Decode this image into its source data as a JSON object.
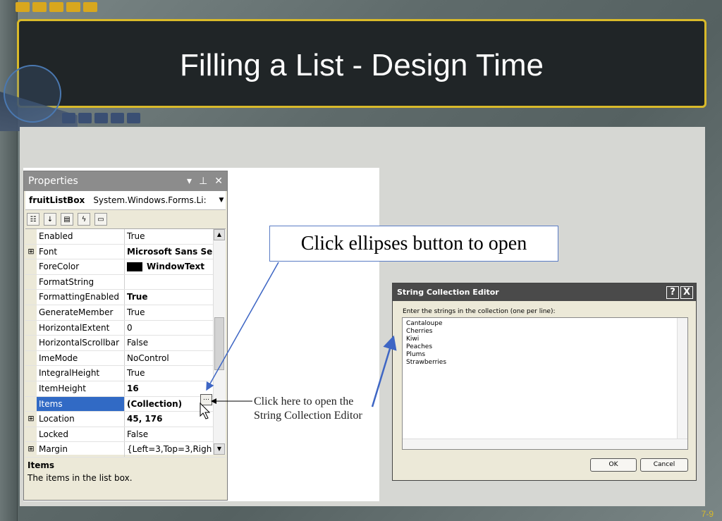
{
  "slide": {
    "title": "Filling a List - Design Time",
    "page_number": "7-9"
  },
  "colors": {
    "title_bg": "#202527",
    "title_border": "#d9ba2a",
    "accent_blue": "#4a78b0",
    "selection": "#316ac5"
  },
  "properties_window": {
    "title": "Properties",
    "object_name": "fruitListBox",
    "object_type": "System.Windows.Forms.Li:",
    "icons": [
      "dropdown-icon",
      "pin-icon",
      "close-icon"
    ],
    "rows": [
      {
        "name": "Enabled",
        "value": "True"
      },
      {
        "name": "Font",
        "value": "Microsoft Sans Se",
        "expand": "⊞"
      },
      {
        "name": "ForeColor",
        "value": "WindowText"
      },
      {
        "name": "FormatString",
        "value": ""
      },
      {
        "name": "FormattingEnabled",
        "value": "True"
      },
      {
        "name": "GenerateMember",
        "value": "True"
      },
      {
        "name": "HorizontalExtent",
        "value": "0"
      },
      {
        "name": "HorizontalScrollbar",
        "value": "False"
      },
      {
        "name": "ImeMode",
        "value": "NoControl"
      },
      {
        "name": "IntegralHeight",
        "value": "True"
      },
      {
        "name": "ItemHeight",
        "value": "16"
      },
      {
        "name": "Items",
        "value": "(Collection)"
      },
      {
        "name": "Location",
        "value": "45, 176",
        "expand": "⊞"
      },
      {
        "name": "Locked",
        "value": "False"
      },
      {
        "name": "Margin",
        "value": "{Left=3,Top=3,Righ",
        "expand": "⊞"
      }
    ],
    "description_title": "Items",
    "description_text": "The items in the list box."
  },
  "callout": {
    "text": "Click ellipses button to open"
  },
  "note": {
    "line1": "Click here to open the",
    "line2": "String Collection Editor"
  },
  "string_collection_editor": {
    "title": "String Collection Editor",
    "help_button": "?",
    "close_button": "X",
    "label": "Enter the strings in the collection (one per line):",
    "items": [
      "Cantaloupe",
      "Cherries",
      "Kiwi",
      "Peaches",
      "Plums",
      "Strawberries"
    ],
    "ok_label": "OK",
    "cancel_label": "Cancel"
  }
}
